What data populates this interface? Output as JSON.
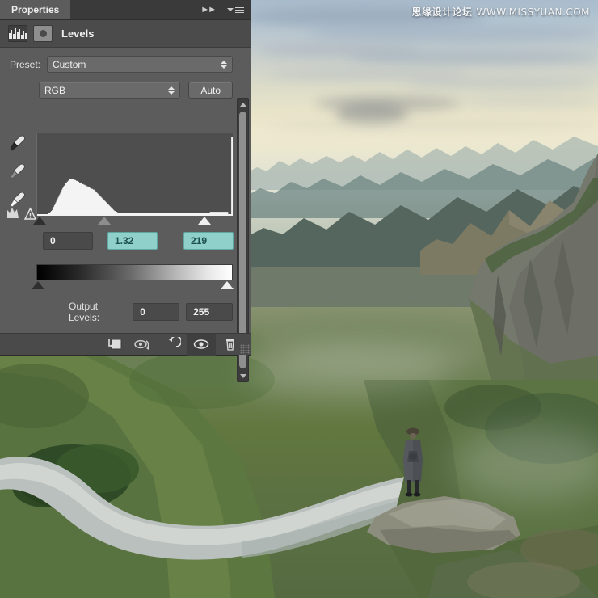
{
  "panel": {
    "tab_label": "Properties",
    "collapse_icon": "double-chevron-right-icon",
    "menu_icon": "panel-menu-icon",
    "adjustment_icon": "levels-histogram-icon",
    "mask_icon": "layer-mask-icon",
    "title": "Levels",
    "preset": {
      "label": "Preset:",
      "value": "Custom",
      "stepper_icon": "stepper-arrows-icon"
    },
    "channel": {
      "value": "RGB",
      "stepper_icon": "stepper-arrows-icon"
    },
    "auto_button": "Auto",
    "eyedroppers": [
      {
        "name": "set-black-point-eyedropper"
      },
      {
        "name": "set-gray-point-eyedropper"
      },
      {
        "name": "set-white-point-eyedropper"
      }
    ],
    "clipping_warning_icon": "clipping-warning-icon",
    "input_levels": {
      "shadow": "0",
      "midtone": "1.32",
      "highlight": "219",
      "highlight_color": "#8fd0cb"
    },
    "output_levels": {
      "label": "Output Levels:",
      "shadow": "0",
      "highlight": "255"
    },
    "toolbar": [
      {
        "name": "clip-to-layer-button",
        "icon": "clip-to-layer-icon"
      },
      {
        "name": "view-previous-state-button",
        "icon": "view-previous-state-icon"
      },
      {
        "name": "reset-button",
        "icon": "reset-arrow-icon"
      },
      {
        "name": "toggle-visibility-button",
        "icon": "eye-icon"
      },
      {
        "name": "delete-layer-button",
        "icon": "trash-icon"
      }
    ],
    "scrollbar": {
      "up_icon": "scroll-up-arrow-icon",
      "down_icon": "scroll-down-arrow-icon"
    }
  },
  "histogram": {
    "bins": [
      0,
      0,
      0,
      0,
      0,
      0,
      0,
      0,
      0,
      0,
      1,
      1,
      2,
      2,
      3,
      3,
      4,
      5,
      6,
      7,
      9,
      11,
      13,
      15,
      17,
      19,
      21,
      23,
      25,
      27,
      29,
      31,
      33,
      35,
      37,
      38,
      40,
      41,
      42,
      43,
      44,
      45,
      46,
      46,
      47,
      47,
      47,
      46,
      46,
      45,
      45,
      44,
      44,
      43,
      43,
      42,
      42,
      41,
      41,
      40,
      40,
      39,
      39,
      38,
      38,
      37,
      37,
      36,
      36,
      35,
      35,
      34,
      34,
      33,
      33,
      32,
      31,
      30,
      29,
      28,
      27,
      26,
      25,
      24,
      23,
      22,
      21,
      20,
      19,
      18,
      17,
      16,
      15,
      14,
      13,
      12,
      11,
      10,
      9,
      8,
      7,
      6,
      6,
      5,
      5,
      4,
      4,
      4,
      3,
      3,
      3,
      3,
      3,
      3,
      3,
      3,
      3,
      3,
      3,
      3,
      3,
      3,
      3,
      3,
      3,
      3,
      3,
      3,
      3,
      3,
      3,
      3,
      3,
      3,
      3,
      3,
      3,
      3,
      3,
      3,
      3,
      3,
      3,
      3,
      3,
      3,
      3,
      3,
      3,
      3,
      3,
      3,
      3,
      3,
      3,
      3,
      3,
      3,
      3,
      3,
      3,
      3,
      3,
      3,
      3,
      3,
      3,
      3,
      3,
      3,
      3,
      3,
      3,
      3,
      3,
      3,
      3,
      3,
      3,
      3,
      3,
      3,
      3,
      3,
      3,
      3,
      3,
      3,
      3,
      3,
      3,
      3,
      3,
      3,
      3,
      3,
      4,
      4,
      4,
      4,
      4,
      4,
      4,
      4,
      4,
      4,
      4,
      4,
      4,
      4,
      4,
      4,
      4,
      4,
      4,
      4,
      4,
      4,
      4,
      4,
      4,
      4,
      4,
      4,
      4,
      4,
      5,
      5,
      5,
      5,
      5,
      5,
      5,
      5,
      5,
      5,
      5,
      5,
      5,
      5,
      5,
      5,
      5,
      5,
      5,
      5,
      5,
      5,
      5,
      5,
      0,
      0,
      0,
      0,
      100,
      100
    ]
  },
  "photo": {
    "watermark_cn": "思缘设计论坛",
    "watermark_en": "WWW.MISSYUAN.COM",
    "description": "mountain-valley-landscape-with-standing-figure"
  }
}
